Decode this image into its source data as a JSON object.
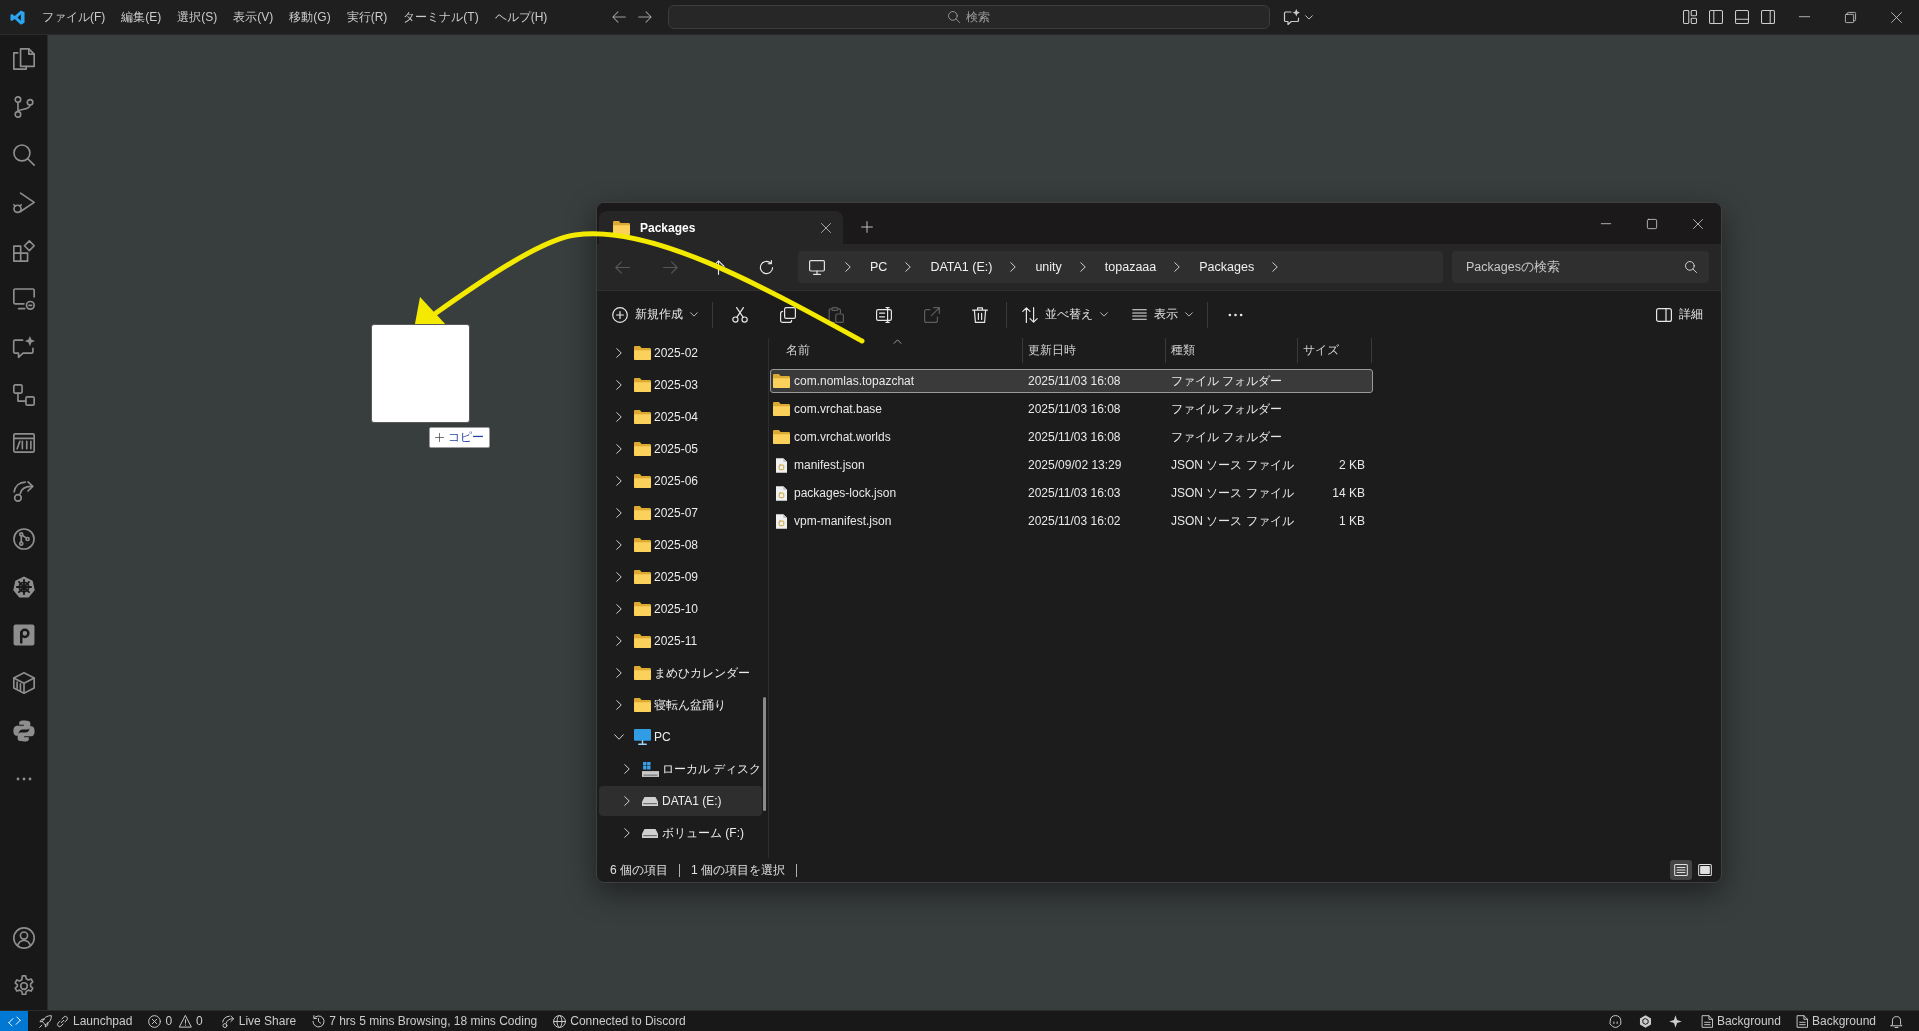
{
  "window": {
    "menu": [
      "ファイル(F)",
      "編集(E)",
      "選択(S)",
      "表示(V)",
      "移動(G)",
      "実行(R)",
      "ターミナル(T)",
      "ヘルプ(H)"
    ],
    "command_center": {
      "label": "検索"
    }
  },
  "drag_preview": {
    "effect": "コピー"
  },
  "file_explorer": {
    "tabs": [
      {
        "label": "Packages",
        "selected": true
      }
    ],
    "nav_buttons": [
      {
        "kind": "back",
        "disabled": true
      },
      {
        "kind": "forward",
        "disabled": true
      },
      {
        "kind": "up",
        "disabled": false
      },
      {
        "kind": "refresh",
        "disabled": false
      }
    ],
    "address": [
      "PC",
      "DATA1 (E:)",
      "unity",
      "topazaaa",
      "Packages"
    ],
    "search": {
      "placeholder": "Packagesの検索"
    },
    "toolbar": [
      [
        {
          "kind": "new",
          "label": "新規作成",
          "dropdown": true,
          "disabled": false
        }
      ],
      [
        {
          "kind": "cut",
          "dropdown": false,
          "disabled": false
        },
        {
          "kind": "copy",
          "dropdown": false,
          "disabled": false
        },
        {
          "kind": "paste",
          "dropdown": false,
          "disabled": true
        },
        {
          "kind": "rename",
          "dropdown": false,
          "disabled": false
        },
        {
          "kind": "share",
          "dropdown": false,
          "disabled": true
        },
        {
          "kind": "delete",
          "dropdown": false,
          "disabled": false
        }
      ],
      [
        {
          "kind": "sort",
          "label": "並べ替え",
          "dropdown": true,
          "disabled": false
        },
        {
          "kind": "view",
          "label": "表示",
          "dropdown": true,
          "disabled": false
        }
      ],
      [
        {
          "kind": "more",
          "dropdown": false,
          "disabled": false
        }
      ]
    ],
    "details_button": {
      "label": "詳細"
    },
    "navigation_pane": [
      {
        "label": "2025-02",
        "kind": "folder",
        "expanded": false,
        "selected": false
      },
      {
        "label": "2025-03",
        "kind": "folder",
        "expanded": false,
        "selected": false
      },
      {
        "label": "2025-04",
        "kind": "folder",
        "expanded": false,
        "selected": false
      },
      {
        "label": "2025-05",
        "kind": "folder",
        "expanded": false,
        "selected": false
      },
      {
        "label": "2025-06",
        "kind": "folder",
        "expanded": false,
        "selected": false
      },
      {
        "label": "2025-07",
        "kind": "folder",
        "expanded": false,
        "selected": false
      },
      {
        "label": "2025-08",
        "kind": "folder",
        "expanded": false,
        "selected": false
      },
      {
        "label": "2025-09",
        "kind": "folder",
        "expanded": false,
        "selected": false
      },
      {
        "label": "2025-10",
        "kind": "folder",
        "expanded": false,
        "selected": false
      },
      {
        "label": "2025-11",
        "kind": "folder",
        "expanded": false,
        "selected": false
      },
      {
        "label": "まめひカレンダー",
        "kind": "folder",
        "expanded": false,
        "selected": false
      },
      {
        "label": "寝転ん盆踊り",
        "kind": "folder",
        "expanded": false,
        "selected": false
      },
      {
        "label": "PC",
        "kind": "computer",
        "expanded": true,
        "selected": false,
        "children": [
          {
            "label": "ローカル ディスク",
            "kind": "system-drive",
            "expanded": false,
            "selected": false
          },
          {
            "label": "DATA1 (E:)",
            "kind": "drive",
            "expanded": false,
            "selected": true
          },
          {
            "label": "ボリューム (F:)",
            "kind": "drive",
            "expanded": false,
            "selected": false
          }
        ]
      }
    ],
    "file_list": {
      "columns": [
        {
          "label": "名前",
          "sorted": true
        },
        {
          "label": "更新日時",
          "sorted": false
        },
        {
          "label": "種類",
          "sorted": false
        },
        {
          "label": "サイズ",
          "sorted": false
        }
      ],
      "rows": [
        {
          "kind": "folder",
          "name": "com.nomlas.topazchat",
          "modified": "2025/11/03 16:08",
          "type": "ファイル フォルダー",
          "selected": true
        },
        {
          "kind": "folder",
          "name": "com.vrchat.base",
          "modified": "2025/11/03 16:08",
          "type": "ファイル フォルダー",
          "selected": false
        },
        {
          "kind": "folder",
          "name": "com.vrchat.worlds",
          "modified": "2025/11/03 16:08",
          "type": "ファイル フォルダー",
          "selected": false
        },
        {
          "kind": "file",
          "name": "manifest.json",
          "modified": "2025/09/02 13:29",
          "type": "JSON ソース ファイル",
          "size": "2 KB",
          "selected": false
        },
        {
          "kind": "file",
          "name": "packages-lock.json",
          "modified": "2025/11/03 16:03",
          "type": "JSON ソース ファイル",
          "size": "14 KB",
          "selected": false
        },
        {
          "kind": "file",
          "name": "vpm-manifest.json",
          "modified": "2025/11/03 16:02",
          "type": "JSON ソース ファイル",
          "size": "1 KB",
          "selected": false
        }
      ]
    },
    "status": {
      "item_count": "6 個の項目",
      "selection": "1 個の項目を選択"
    },
    "view_buttons": [
      {
        "kind": "details",
        "selected": true
      },
      {
        "kind": "tiles",
        "selected": false
      }
    ]
  },
  "status_bar": {
    "left": [
      {
        "kind": "launchpad",
        "label": "Launchpad"
      },
      {
        "kind": "problems",
        "errors": "0",
        "warnings": "0"
      },
      {
        "kind": "live-share",
        "label": "Live Share"
      },
      {
        "kind": "time",
        "label": "7 hrs 5 mins Browsing, 18 mins Coding"
      },
      {
        "kind": "discord",
        "label": "Connected to Discord"
      }
    ],
    "right": [
      {
        "kind": "background",
        "label": "Background"
      },
      {
        "kind": "background",
        "label": "Background"
      }
    ]
  }
}
